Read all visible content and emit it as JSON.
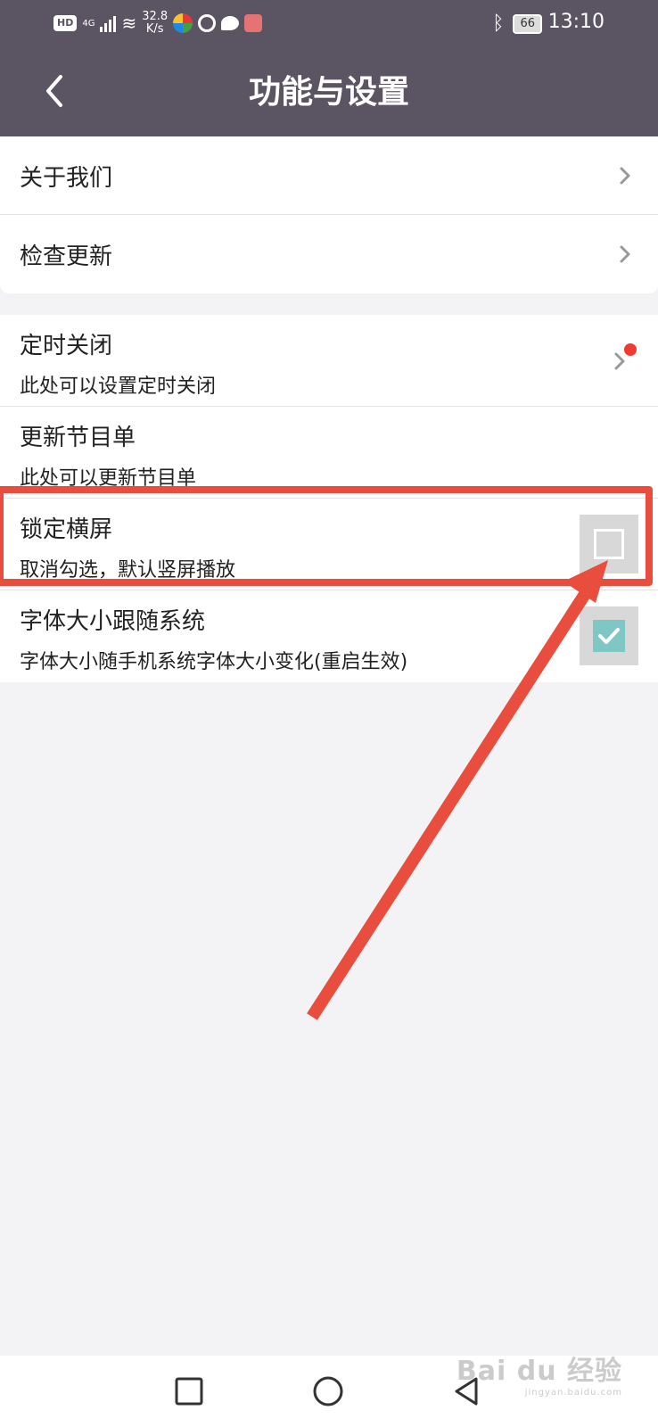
{
  "status_bar": {
    "hd": "HD",
    "network": "4G",
    "speed_value": "32.8",
    "speed_unit": "K/s",
    "battery": "66",
    "time": "13:10"
  },
  "header": {
    "title": "功能与设置",
    "back_icon": "chevron-left-icon"
  },
  "group1": [
    {
      "label": "关于我们"
    },
    {
      "label": "检查更新"
    }
  ],
  "group2": [
    {
      "label": "定时关闭",
      "sub": "此处可以设置定时关闭",
      "indicator": "red-dot"
    },
    {
      "label": "更新节目单",
      "sub": "此处可以更新节目单"
    },
    {
      "label": "锁定横屏",
      "sub": "取消勾选，默认竖屏播放",
      "checked": false
    },
    {
      "label": "字体大小跟随系统",
      "sub": "字体大小随手机系统字体大小变化(重启生效)",
      "checked": true
    }
  ],
  "annotation": {
    "color": "#e84d3d"
  },
  "nav_bar": {
    "icons": [
      "square-icon",
      "circle-icon",
      "triangle-back-icon"
    ]
  },
  "watermark": {
    "brand": "Bai du 经验",
    "url": "jingyan.baidu.com"
  },
  "colors": {
    "appbar": "#5b5563",
    "accent_check": "#7fc7c5",
    "dot": "#ef3b32"
  }
}
